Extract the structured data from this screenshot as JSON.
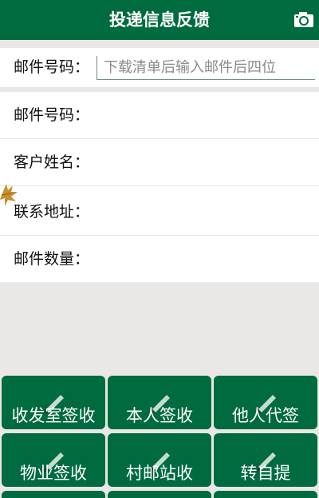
{
  "header": {
    "title": "投递信息反馈"
  },
  "search": {
    "label": "邮件号码：",
    "placeholder": "下载清单后输入邮件后四位"
  },
  "info_rows": [
    {
      "label": "邮件号码："
    },
    {
      "label": "客户姓名："
    },
    {
      "label": "联系地址："
    },
    {
      "label": "邮件数量："
    }
  ],
  "buttons": [
    {
      "label": "收发室签收"
    },
    {
      "label": "本人签收"
    },
    {
      "label": "他人代签"
    },
    {
      "label": "物业签收"
    },
    {
      "label": "村邮站收"
    },
    {
      "label": "转自提"
    }
  ],
  "colors": {
    "primary": "#006b3f",
    "background": "#e9e8e6"
  },
  "icons": [
    "camera-icon",
    "pencil-icon",
    "leaf-icon"
  ]
}
